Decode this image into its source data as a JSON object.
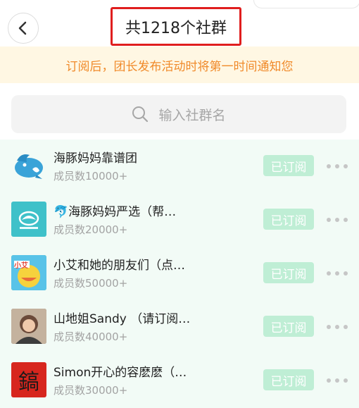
{
  "header": {
    "title": "共1218个社群"
  },
  "notice": {
    "text": "订阅后，团长发布活动时将第一时间通知您"
  },
  "search": {
    "placeholder": "输入社群名"
  },
  "groups": [
    {
      "name": "海豚妈妈靠谱团",
      "members": "成员数10000+",
      "button": "已订阅"
    },
    {
      "name": "🐬海豚妈妈严选（帮…",
      "members": "成员数20000+",
      "button": "已订阅"
    },
    {
      "name": "小艾和她的朋友们（点…",
      "members": "成员数50000+",
      "button": "已订阅"
    },
    {
      "name": "山地姐Sandy （请订阅…",
      "members": "成员数40000+",
      "button": "已订阅"
    },
    {
      "name": "Simon开心的容麽麽（…",
      "members": "成员数30000+",
      "button": "已订阅"
    }
  ],
  "avatars": {
    "a3_text": "小艾",
    "a5_char": "鎬"
  },
  "colors": {
    "title_border": "#e01e1e",
    "notice_bg": "#fff7e3",
    "notice_text": "#f08a2a",
    "list_bg": "#f2fbf6",
    "subscribed_button": "#bfeed5"
  }
}
